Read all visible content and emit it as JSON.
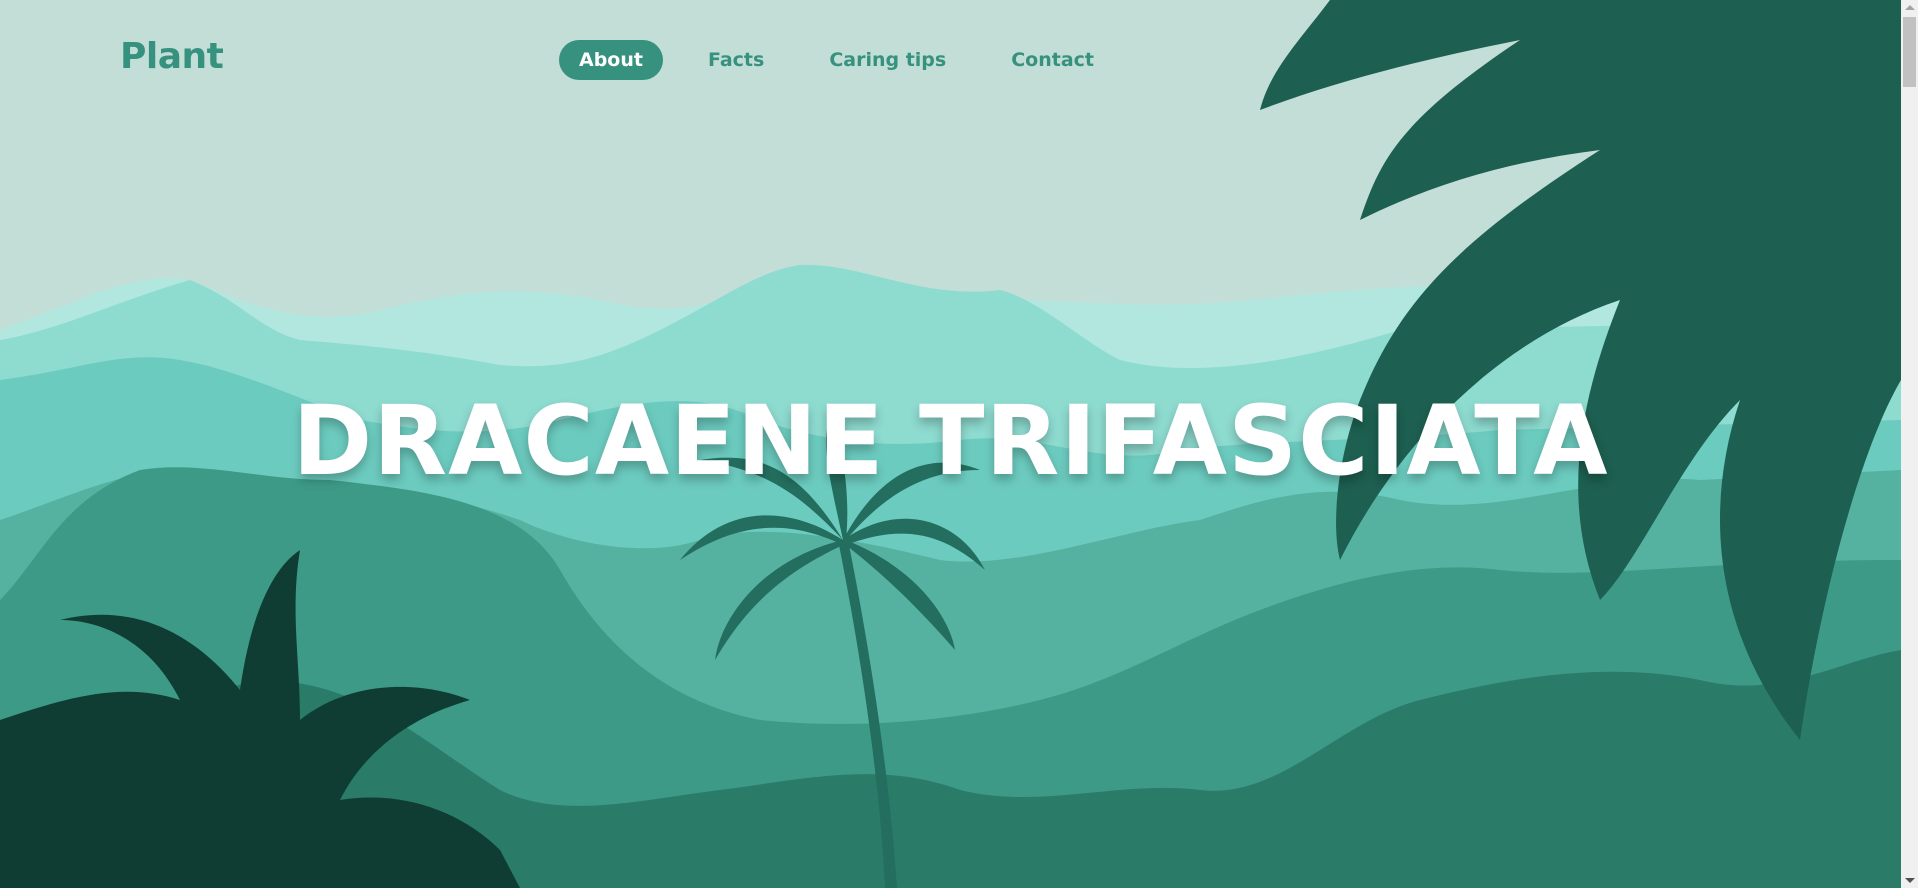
{
  "nav": {
    "logo": "Plant",
    "items": [
      {
        "label": "About",
        "active": true
      },
      {
        "label": "Facts",
        "active": false
      },
      {
        "label": "Caring tips",
        "active": false
      },
      {
        "label": "Contact",
        "active": false
      }
    ]
  },
  "hero": {
    "title": "DRACAENE TRIFASCIATA"
  },
  "colors": {
    "accent": "#36927f",
    "sky": "#c3ded7",
    "title": "#ffffff"
  }
}
